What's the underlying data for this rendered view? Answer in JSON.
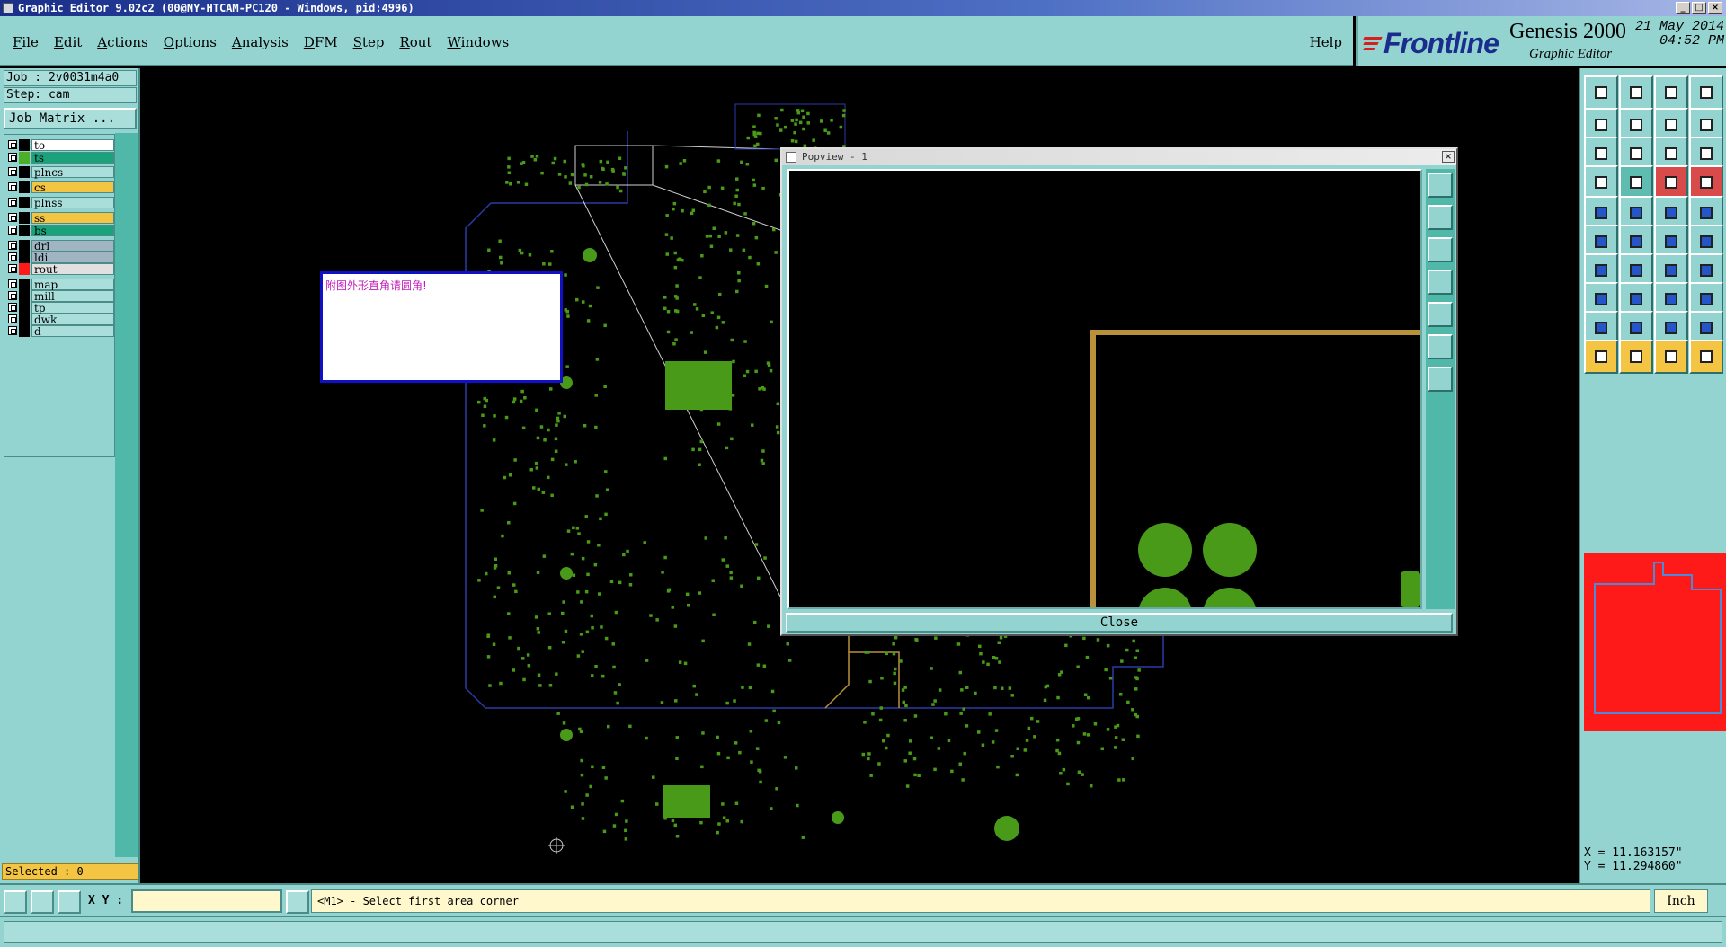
{
  "window": {
    "title": "Graphic Editor 9.02c2 (00@NY-HTCAM-PC120 - Windows, pid:4996)",
    "controls": [
      "_",
      "□",
      "×"
    ]
  },
  "menu": {
    "items": [
      "File",
      "Edit",
      "Actions",
      "Options",
      "Analysis",
      "DFM",
      "Step",
      "Rout",
      "Windows"
    ],
    "help": "Help"
  },
  "brand": {
    "logo": "Frontline",
    "product": "Genesis 2000",
    "subtitle": "Graphic Editor",
    "date": "21 May 2014",
    "time": "04:52 PM"
  },
  "job": {
    "job_label": "Job : 2v0031m4a0",
    "step_label": "Step: cam",
    "matrix_button": "Job Matrix ..."
  },
  "layers": [
    {
      "name": "to",
      "color": "#ffffff",
      "swatch": "#000000"
    },
    {
      "name": "ts",
      "color": "#1aa27a",
      "swatch": "#4caf2a"
    },
    {
      "name": "plncs",
      "color": "#a9dedb",
      "swatch": "#000000"
    },
    {
      "name": "cs",
      "color": "#f4c542",
      "swatch": "#000000"
    },
    {
      "name": "plnss",
      "color": "#a9dedb",
      "swatch": "#000000"
    },
    {
      "name": "ss",
      "color": "#f4c542",
      "swatch": "#000000"
    },
    {
      "name": "bs",
      "color": "#1aa27a",
      "swatch": "#000000"
    },
    {
      "name": "drl",
      "color": "#9fb6c2",
      "swatch": "#000000"
    },
    {
      "name": "ldi",
      "color": "#9fb6c2",
      "swatch": "#000000"
    },
    {
      "name": "rout",
      "color": "#e0e0e0",
      "swatch": "#ff1a1a"
    },
    {
      "name": "map",
      "color": "#a9dedb",
      "swatch": "#000000"
    },
    {
      "name": "mill",
      "color": "#a9dedb",
      "swatch": "#000000"
    },
    {
      "name": "tp",
      "color": "#a9dedb",
      "swatch": "#000000"
    },
    {
      "name": "dwk",
      "color": "#a9dedb",
      "swatch": "#000000"
    },
    {
      "name": "d",
      "color": "#a9dedb",
      "swatch": "#000000"
    }
  ],
  "selected_label": "Selected : 0",
  "note_text": "附图外形直角请圆角!",
  "popview": {
    "title": "Popview - 1",
    "close_label": "Close"
  },
  "coords": {
    "x": "X = 11.163157\"",
    "y": "Y = 11.294860\""
  },
  "bottom": {
    "xy_label": "X Y :",
    "xy_value": "",
    "message": "<M1> - Select first area corner",
    "units": "Inch"
  },
  "colors": {
    "panel": "#93d3d0",
    "copper": "#4a9a1a",
    "rout": "#b8913a",
    "outline": "#2a3aa8"
  }
}
